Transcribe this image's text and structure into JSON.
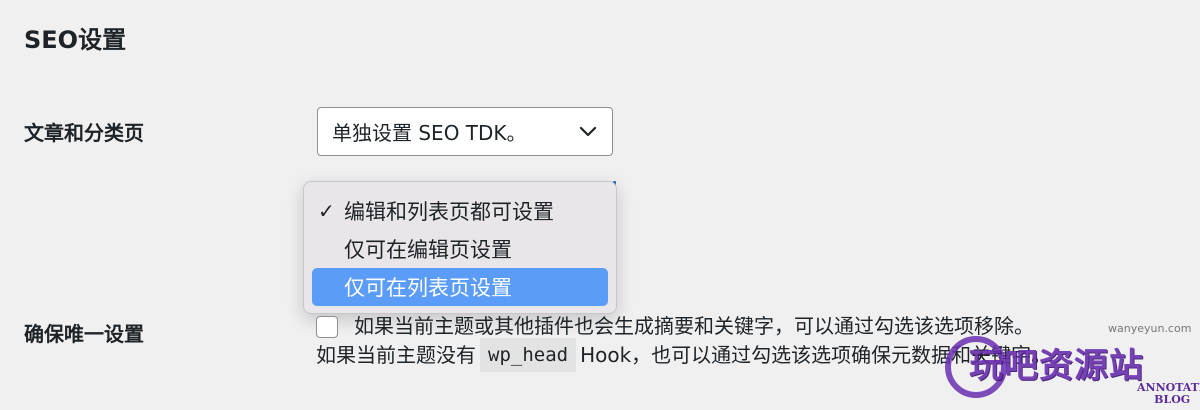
{
  "section": {
    "title": "SEO设置"
  },
  "fields": {
    "posts_label": "文章和分类页",
    "unique_label": "确保唯一设置"
  },
  "select": {
    "value": "单独设置 SEO TDK。",
    "options": [
      {
        "label": "编辑和列表页都可设置",
        "checked": true,
        "highlighted": false
      },
      {
        "label": "仅可在编辑页设置",
        "checked": false,
        "highlighted": false
      },
      {
        "label": "仅可在列表页设置",
        "checked": false,
        "highlighted": true
      }
    ]
  },
  "checkbox": {
    "checked": false,
    "label": "如果当前主题或其他插件也会生成摘要和关键字，可以通过勾选该选项移除。"
  },
  "description": {
    "before": "如果当前主题没有",
    "code": "wp_head",
    "after": "Hook，也可以通过勾选该选项确保元数据和关键字。"
  },
  "watermark": {
    "small": "wanyeyun.com",
    "main": "玩吧资源站",
    "blog": "ANNOTATE BLOG"
  },
  "colors": {
    "background": "#f0f0f1",
    "highlight": "#5a9cf8",
    "accent": "#2271b1",
    "watermark": "#6a2fb0"
  }
}
